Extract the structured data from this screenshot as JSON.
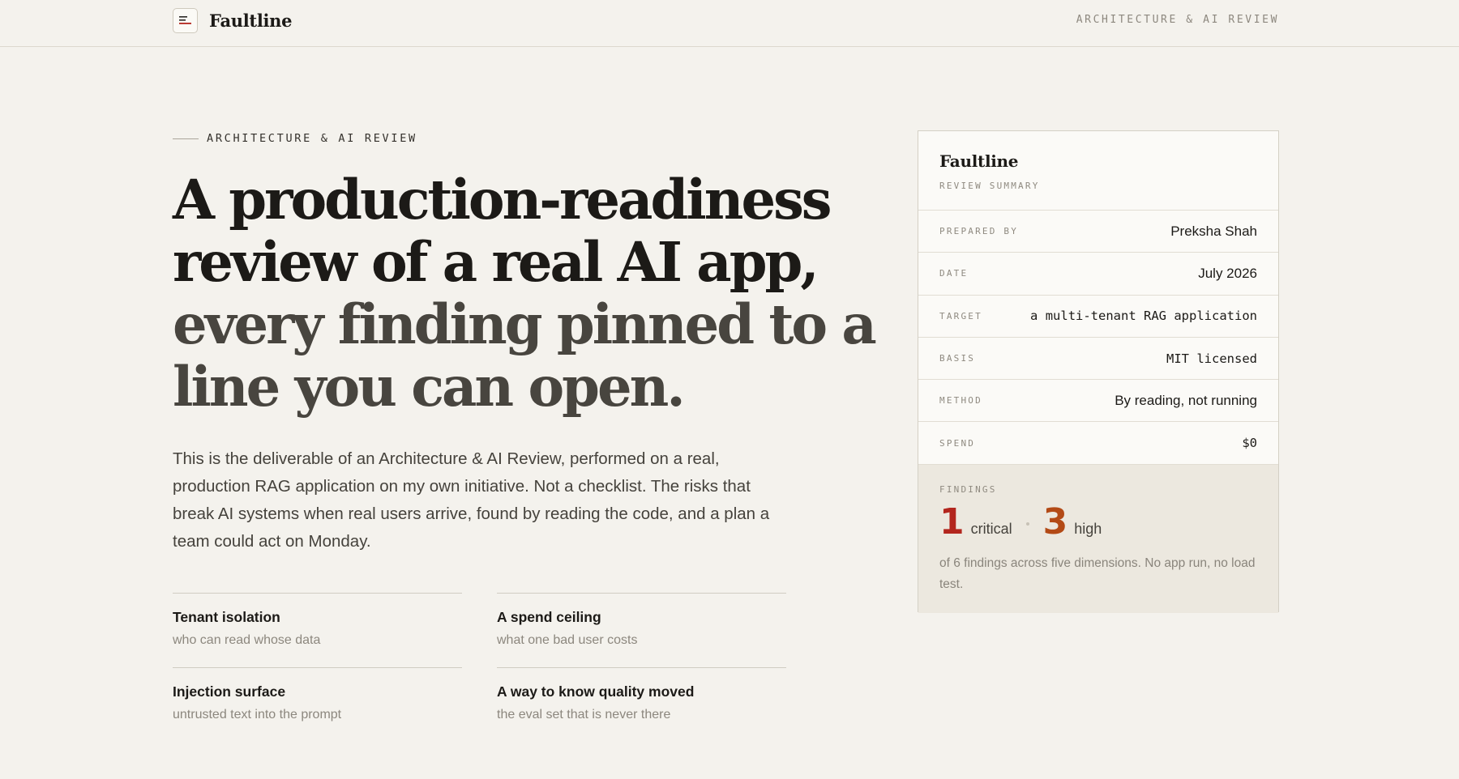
{
  "header": {
    "brand": "Faultline",
    "nav_label": "ARCHITECTURE & AI REVIEW"
  },
  "hero": {
    "eyebrow": "ARCHITECTURE & AI REVIEW",
    "headline_lines": [
      "A production-readiness",
      "review of a real AI app,",
      "every finding pinned to a",
      "line you can open."
    ],
    "intro": "This is the deliverable of an Architecture & AI Review, performed on a real, production RAG application on my own initiative. Not a checklist. The risks that break AI systems when real users arrive, found by reading the code, and a plan a team could act on Monday."
  },
  "features": [
    {
      "title": "Tenant isolation",
      "subtitle": "who can read whose data"
    },
    {
      "title": "A spend ceiling",
      "subtitle": "what one bad user costs"
    },
    {
      "title": "Injection surface",
      "subtitle": "untrusted text into the prompt"
    },
    {
      "title": "A way to know quality moved",
      "subtitle": "the eval set that is never there"
    }
  ],
  "summary_card": {
    "title": "Faultline",
    "subtitle": "REVIEW SUMMARY",
    "rows": [
      {
        "label": "PREPARED BY",
        "value": "Preksha Shah"
      },
      {
        "label": "DATE",
        "value": "July 2026"
      },
      {
        "label": "TARGET",
        "value": "a multi-tenant RAG application"
      },
      {
        "label": "BASIS",
        "value": "MIT licensed"
      },
      {
        "label": "METHOD",
        "value": "By reading, not running"
      },
      {
        "label": "SPEND",
        "value": "$0"
      }
    ],
    "findings": {
      "label": "FINDINGS",
      "critical_count": "1",
      "critical_label": "critical",
      "high_count": "3",
      "high_label": "high",
      "note": "of 6 findings across five dimensions. No app run, no load test."
    }
  },
  "colors": {
    "background": "#f4f2ed",
    "critical": "#b3261e",
    "high": "#b34a16",
    "text": "#1c1a17"
  },
  "icons": {
    "brand": "menu-lines-icon"
  }
}
